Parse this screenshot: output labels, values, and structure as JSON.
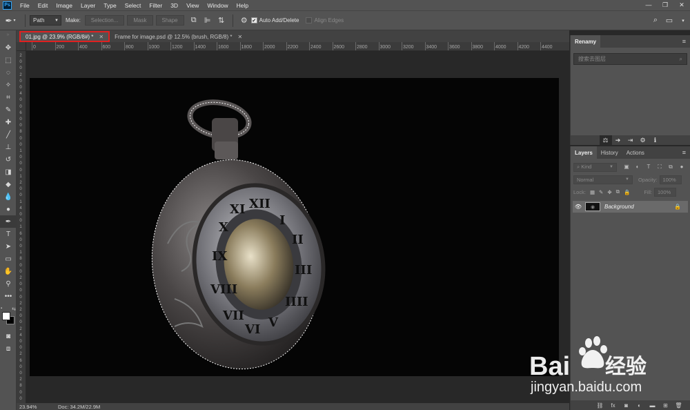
{
  "app": {
    "logo": "Ps",
    "accent": "#31a8ff"
  },
  "menu": [
    "File",
    "Edit",
    "Image",
    "Layer",
    "Type",
    "Select",
    "Filter",
    "3D",
    "View",
    "Window",
    "Help"
  ],
  "options": {
    "mode_value": "Path",
    "make_label": "Make:",
    "selection_label": "Selection...",
    "mask_label": "Mask",
    "shape_label": "Shape",
    "auto_add_delete_label": "Auto Add/Delete",
    "auto_add_delete_checked": true,
    "align_edges_label": "Align Edges",
    "align_edges_checked": false
  },
  "tabs": [
    {
      "label": "01.jpg @ 23.9% (RGB/8#) *",
      "active": true,
      "highlight_color": "#e02020"
    },
    {
      "label": "Frame for image.psd @ 12.5% (brush, RGB/8) *",
      "active": false
    }
  ],
  "ruler": {
    "h_ticks": [
      "0",
      "200",
      "400",
      "600",
      "800",
      "1000",
      "1200",
      "1400",
      "1600",
      "1800",
      "2000",
      "2200",
      "2400",
      "2600",
      "2800",
      "3000",
      "3200",
      "3400",
      "3600",
      "3800",
      "4000",
      "4200",
      "4400"
    ],
    "v_ticks": [
      "2",
      "0",
      "0",
      "2",
      "0",
      "0",
      "4",
      "0",
      "0",
      "6",
      "0",
      "0",
      "8",
      "0",
      "0",
      "1",
      "0",
      "0",
      "0",
      "1",
      "2",
      "0",
      "0",
      "1",
      "4",
      "0",
      "0",
      "1",
      "6",
      "0",
      "0",
      "1",
      "8",
      "0",
      "0",
      "2",
      "0",
      "0",
      "0",
      "2",
      "2",
      "0",
      "0",
      "2",
      "4",
      "0",
      "0",
      "2",
      "6",
      "0",
      "0",
      "2",
      "8",
      "0",
      "0"
    ]
  },
  "status": {
    "zoom": "23.94%",
    "doc": "Doc: 34.2M/22.9M"
  },
  "right_top": {
    "tab_label": "Renamy",
    "search_placeholder": "搜索去图层"
  },
  "layers_panel": {
    "tabs": [
      "Layers",
      "History",
      "Actions"
    ],
    "kind_label": "Kind",
    "blend_mode": "Normal",
    "opacity_label": "Opacity:",
    "opacity_value": "100%",
    "lock_label": "Lock:",
    "fill_label": "Fill:",
    "fill_value": "100%",
    "layers": [
      {
        "name": "Background",
        "visible": true,
        "locked": true
      }
    ]
  },
  "watermark": {
    "text_main": "Bai",
    "text_cn": "经验",
    "text_domain": "jingyan.baidu.com"
  },
  "colors": {
    "foreground": "#ffffff",
    "background": "#000000"
  }
}
